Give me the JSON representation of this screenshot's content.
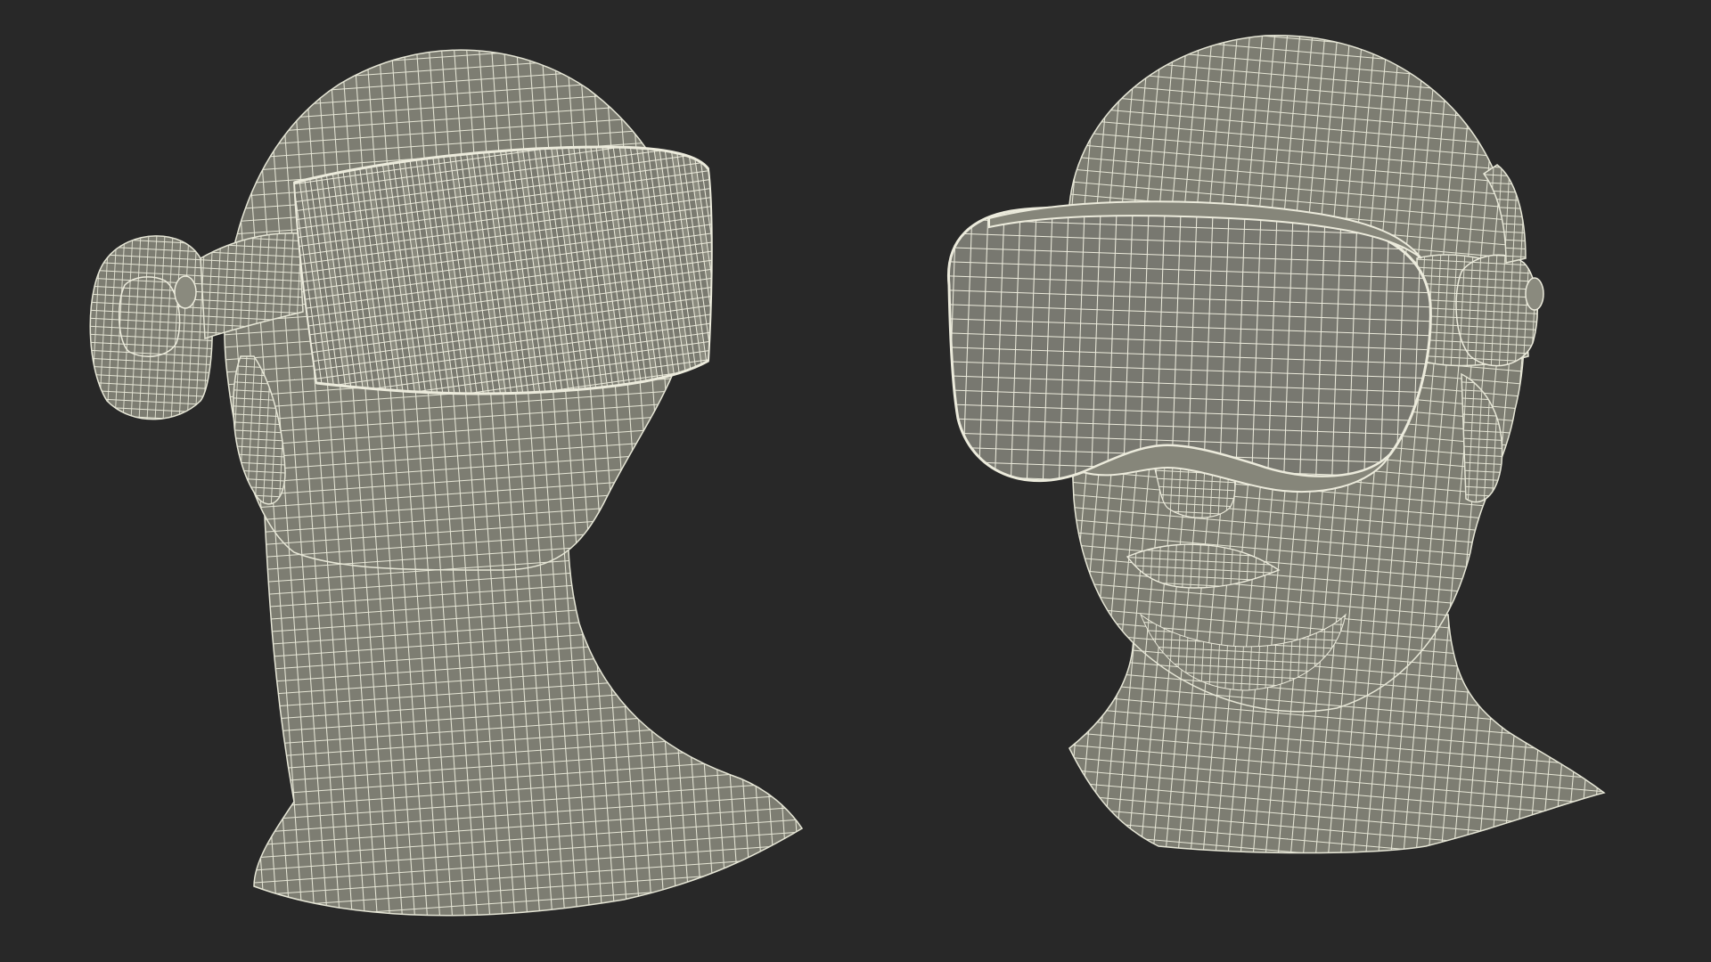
{
  "scene": {
    "background_color": "#282828",
    "surface_color": "#7d7d72",
    "wire_color": "#e6e6d6",
    "views": [
      {
        "name": "rear-three-quarter-view",
        "subject": "head-mannequin-with-headset"
      },
      {
        "name": "front-three-quarter-view",
        "subject": "head-mannequin-with-headset"
      }
    ]
  }
}
